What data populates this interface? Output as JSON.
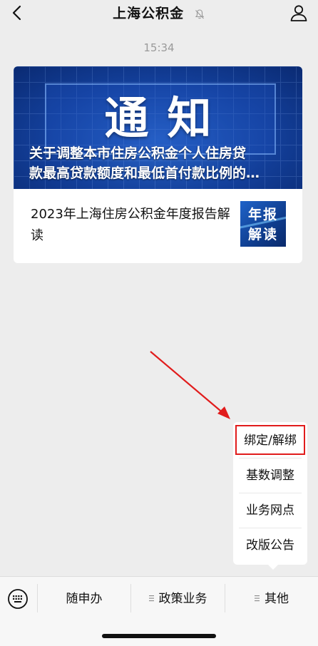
{
  "header": {
    "title": "上海公积金",
    "back_icon": "chevron-left-icon",
    "mute_icon": "bell-muted-icon",
    "profile_icon": "person-icon"
  },
  "chat": {
    "timestamp": "15:34"
  },
  "card": {
    "banner_heading": "通知",
    "banner_caption_line1": "关于调整本市住房公积金个人住房贷",
    "banner_caption_line2": "款最高贷款额度和最低首付款比例的…",
    "article_title": "2023年上海住房公积金年度报告解读",
    "thumbnail_line1": "年报",
    "thumbnail_line2": "解读"
  },
  "popup_menu": {
    "items": [
      {
        "label": "绑定/解绑"
      },
      {
        "label": "基数调整"
      },
      {
        "label": "业务网点"
      },
      {
        "label": "改版公告"
      }
    ],
    "highlight_color": "#e11c1c"
  },
  "annotation": {
    "arrow_color": "#e11c1c"
  },
  "bottom_bar": {
    "keyboard_icon": "keyboard-icon",
    "tabs": [
      {
        "label": "随申办"
      },
      {
        "label": "政策业务"
      },
      {
        "label": "其他"
      }
    ]
  }
}
